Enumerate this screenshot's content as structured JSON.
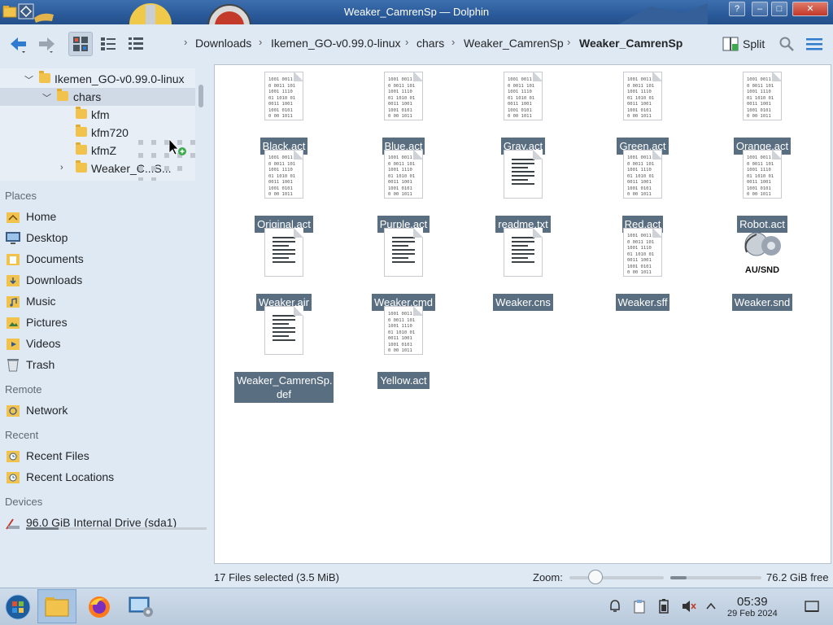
{
  "window": {
    "title": "Weaker_CamrenSp — Dolphin"
  },
  "toolbar": {
    "breadcrumbs": [
      "Downloads",
      "Ikemen_GO-v0.99.0-linux",
      "chars",
      "Weaker_CamrenSp",
      "Weaker_CamrenSp"
    ],
    "split_label": "Split"
  },
  "tree": {
    "items": [
      {
        "label": "Ikemen_GO-v0.99.0-linux"
      },
      {
        "label": "chars"
      },
      {
        "label": "kfm"
      },
      {
        "label": "kfm720"
      },
      {
        "label": "kfmZ"
      },
      {
        "label": "Weaker_C...S..."
      }
    ]
  },
  "places": {
    "heading": "Places",
    "items": [
      {
        "label": "Home",
        "icon": "home-icon"
      },
      {
        "label": "Desktop",
        "icon": "desktop-icon"
      },
      {
        "label": "Documents",
        "icon": "documents-icon"
      },
      {
        "label": "Downloads",
        "icon": "downloads-icon"
      },
      {
        "label": "Music",
        "icon": "music-icon"
      },
      {
        "label": "Pictures",
        "icon": "pictures-icon"
      },
      {
        "label": "Videos",
        "icon": "videos-icon"
      },
      {
        "label": "Trash",
        "icon": "trash-icon"
      }
    ]
  },
  "remote": {
    "heading": "Remote",
    "items": [
      {
        "label": "Network"
      }
    ]
  },
  "recent": {
    "heading": "Recent",
    "items": [
      {
        "label": "Recent Files"
      },
      {
        "label": "Recent Locations"
      }
    ]
  },
  "devices": {
    "heading": "Devices",
    "items": [
      {
        "label": "96.0 GiB Internal Drive (sda1)",
        "used_fraction": 0.18
      }
    ]
  },
  "files": [
    {
      "name": "Black.act",
      "type": "binary"
    },
    {
      "name": "Blue.act",
      "type": "binary"
    },
    {
      "name": "Gray.act",
      "type": "binary"
    },
    {
      "name": "Green.act",
      "type": "binary"
    },
    {
      "name": "Orange.act",
      "type": "binary"
    },
    {
      "name": "Original.act",
      "type": "binary"
    },
    {
      "name": "Purple.act",
      "type": "binary"
    },
    {
      "name": "readme.txt",
      "type": "text"
    },
    {
      "name": "Red.act",
      "type": "binary"
    },
    {
      "name": "Robot.act",
      "type": "binary"
    },
    {
      "name": "Weaker.air",
      "type": "text"
    },
    {
      "name": "Weaker.cmd",
      "type": "text"
    },
    {
      "name": "Weaker.cns",
      "type": "text"
    },
    {
      "name": "Weaker.sff",
      "type": "binary"
    },
    {
      "name": "Weaker.snd",
      "type": "audio",
      "icon_caption": "AU/SND"
    },
    {
      "name": "Weaker_CamrenSp.\ndef",
      "type": "text"
    },
    {
      "name": "Yellow.act",
      "type": "binary"
    }
  ],
  "status": {
    "selection": "17 Files selected (3.5 MiB)",
    "zoom_label": "Zoom:",
    "zoom_fraction": 0.28,
    "free_space": "76.2 GiB free",
    "used_fraction": 0.18
  },
  "taskbar": {
    "time": "05:39",
    "date": "29 Feb 2024"
  },
  "colors": {
    "selection": "#5a6e82",
    "titlebar": "#2a5a9a",
    "accent": "#2f7bd0"
  }
}
